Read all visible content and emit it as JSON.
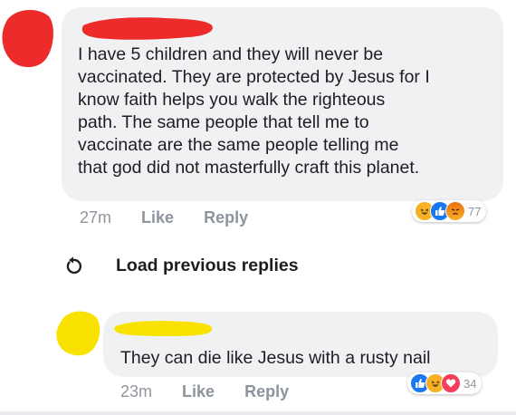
{
  "comment": {
    "text_lines": [
      "I have 5 children and they will never be",
      "vaccinated. They are protected by Jesus for I",
      "know faith helps you walk the righteous",
      "path. The same people that tell me to",
      "vaccinate are the same people telling me",
      "that god did not masterfully craft this planet."
    ],
    "time": "27m",
    "like_label": "Like",
    "reply_label": "Reply",
    "reaction_count": "77",
    "reaction_icons": [
      "haha-icon",
      "like-icon",
      "angry-icon"
    ]
  },
  "load_previous": {
    "label": "Load previous replies",
    "icon": "refresh-icon"
  },
  "reply": {
    "text": "They can die like Jesus with a rusty nail",
    "time": "23m",
    "like_label": "Like",
    "reply_label": "Reply",
    "reaction_count": "34",
    "reaction_icons": [
      "like-icon",
      "haha-icon",
      "love-icon"
    ]
  },
  "colors": {
    "bubble": "#f0f1f3",
    "redaction_red": "#ee2b2b",
    "redaction_yellow": "#f9e200",
    "like_blue": "#1877f2",
    "love_red": "#f33e58",
    "haha_yellow": "#f7b125",
    "angry_orange": "#e9710f"
  }
}
